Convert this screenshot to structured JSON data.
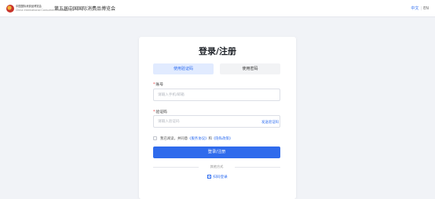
{
  "header": {
    "logo_line1": "中国国际消费品博览会",
    "logo_line2": "China International Consumer Products Expo",
    "site_title": "第五届中国国际消费品博览会",
    "lang_cn": "中文",
    "lang_sep": "|",
    "lang_en": "EN"
  },
  "card": {
    "title": "登录/注册",
    "tabs": [
      {
        "label": "使用验证码",
        "active": true
      },
      {
        "label": "使用密码",
        "active": false
      }
    ],
    "account": {
      "required_mark": "*",
      "label": "账号",
      "placeholder": "请输入手机/邮箱",
      "value": ""
    },
    "code": {
      "required_mark": "*",
      "label": "验证码",
      "placeholder": "请输入验证码",
      "value": "",
      "send_label": "发送验证码"
    },
    "agreement": {
      "prefix": "我已阅读，并同意",
      "terms": "《服务协议》",
      "and": "和",
      "privacy": "《隐私政策》",
      "checked": false
    },
    "submit_label": "登录/注册",
    "other_methods": "其他方式",
    "qr_login": "扫码登录"
  },
  "colors": {
    "accent": "#2f6bec",
    "background": "#f1f3f7"
  }
}
